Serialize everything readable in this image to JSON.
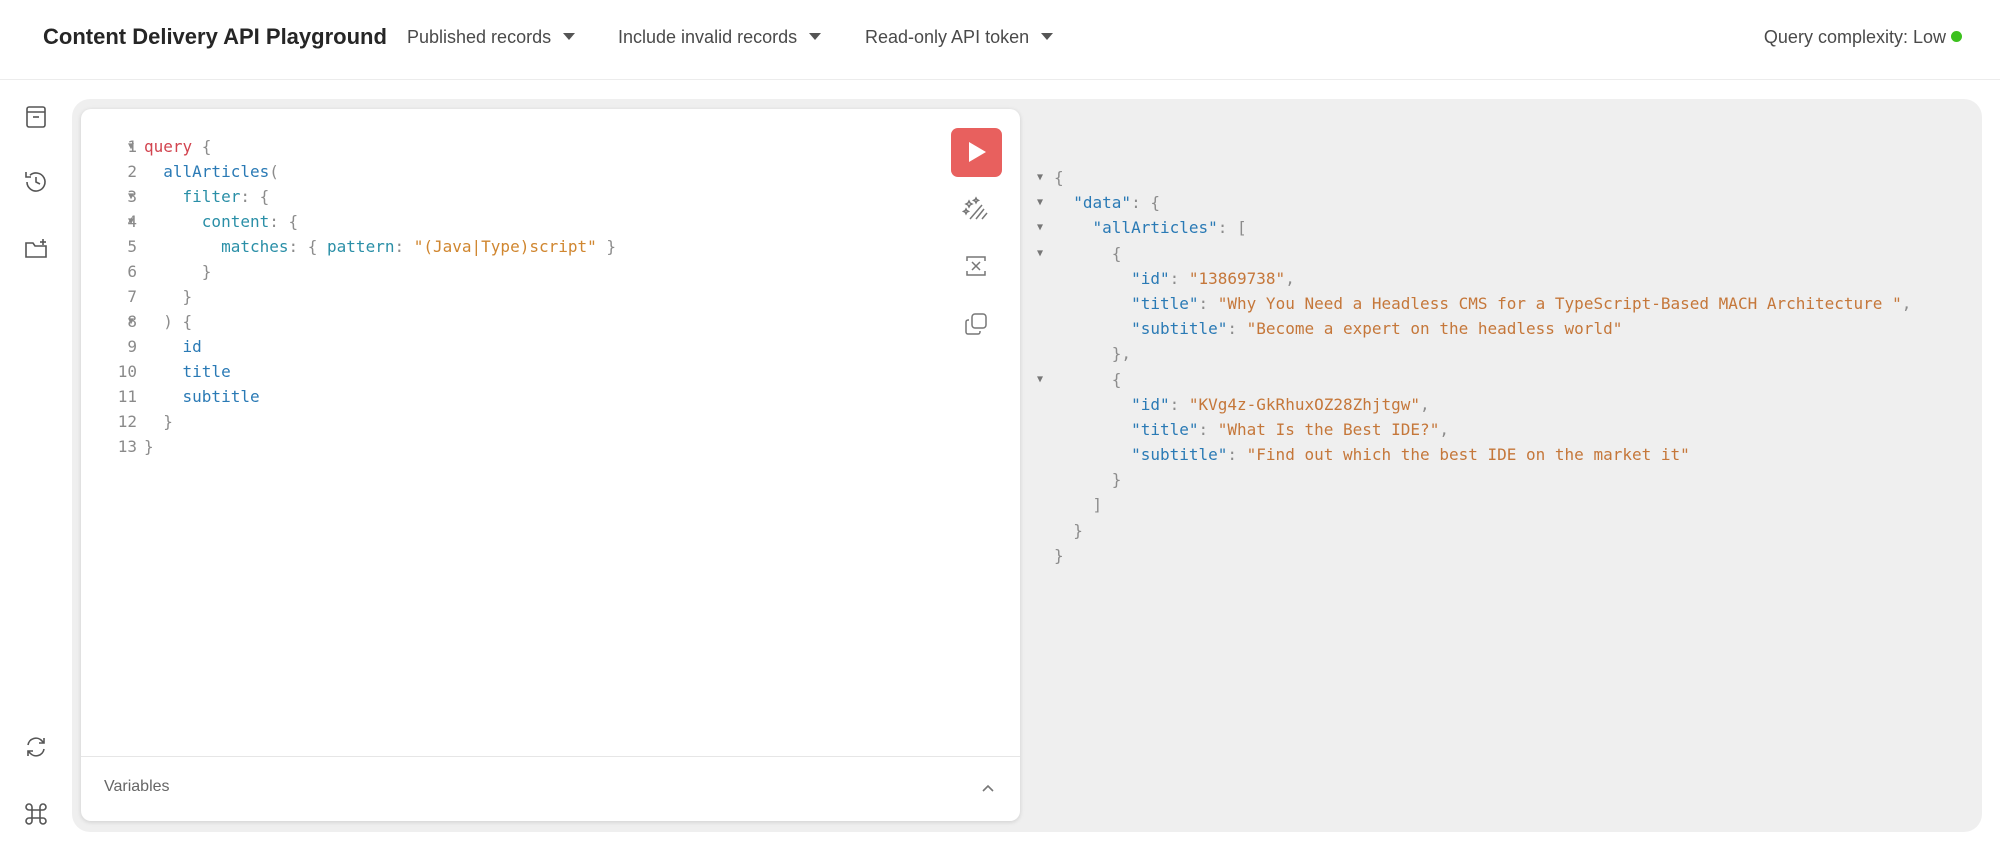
{
  "header": {
    "title": "Content Delivery API Playground",
    "dropdowns": [
      "Published records",
      "Include invalid records",
      "Read-only API token"
    ],
    "complexity_label": "Query complexity: Low",
    "complexity_color": "#3cc11e"
  },
  "sidebar": {
    "icons": [
      "archive-icon",
      "history-icon",
      "folder-add-icon",
      "refresh-icon",
      "command-icon"
    ]
  },
  "editor": {
    "line_numbers": [
      "1",
      "2",
      "3",
      "4",
      "5",
      "6",
      "7",
      "8",
      "9",
      "10",
      "11",
      "12",
      "13"
    ],
    "lines": {
      "l1_kw": "query",
      "l2_fn": "allArticles",
      "l3_prop": "filter",
      "l4_prop": "content",
      "l5_prop": "matches",
      "l5_arg": "pattern",
      "l5_str": "\"(Java|Type)script\"",
      "l9": "id",
      "l10": "title",
      "l11": "subtitle"
    },
    "run_color": "#e8605e",
    "variables_label": "Variables"
  },
  "result": {
    "key_data": "\"data\"",
    "key_allArticles": "\"allArticles\"",
    "articles": [
      {
        "id_key": "\"id\"",
        "id": "\"13869738\"",
        "title_key": "\"title\"",
        "title": "\"Why You Need a Headless CMS for a TypeScript-Based MACH Architecture \"",
        "subtitle_key": "\"subtitle\"",
        "subtitle": "\"Become a expert on the headless world\""
      },
      {
        "id_key": "\"id\"",
        "id": "\"KVg4z-GkRhuxOZ28Zhjtgw\"",
        "title_key": "\"title\"",
        "title": "\"What Is the Best IDE?\"",
        "subtitle_key": "\"subtitle\"",
        "subtitle": "\"Find out which the best IDE on the market it\""
      }
    ]
  }
}
